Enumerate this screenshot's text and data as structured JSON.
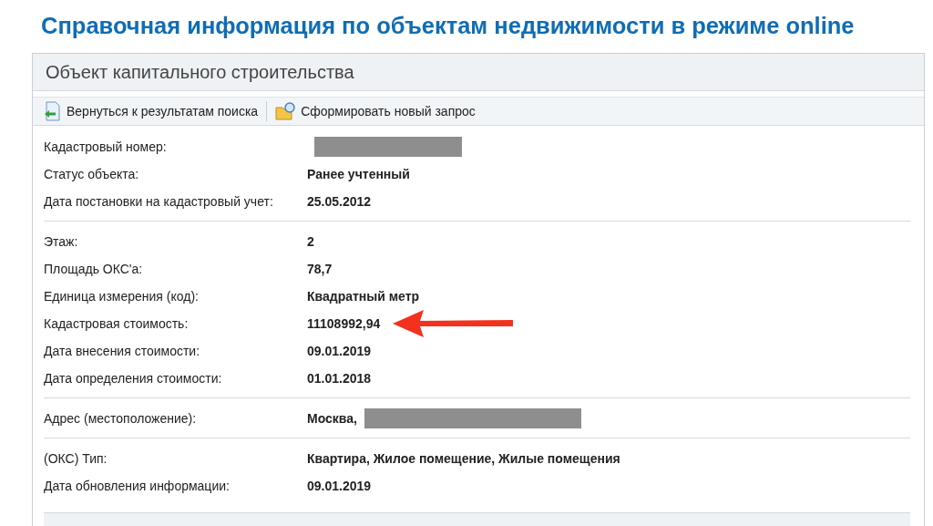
{
  "page_title": "Справочная информация по объектам недвижимости в режиме online",
  "panel": {
    "title": "Объект капитального строительства",
    "toolbar": [
      {
        "label": "Вернуться к результатам поиска",
        "kind": "back"
      },
      {
        "label": "Сформировать новый запрос",
        "kind": "query"
      }
    ],
    "groups": [
      [
        {
          "label": "Кадастровый номер:",
          "redacted": true
        },
        {
          "label": "Статус объекта:",
          "value": "Ранее учтенный"
        },
        {
          "label": "Дата постановки на кадастровый учет:",
          "value": "25.05.2012"
        }
      ],
      [
        {
          "label": "Этаж:",
          "value": "2"
        },
        {
          "label": "Площадь ОКС'а:",
          "value": "78,7"
        },
        {
          "label": "Единица измерения (код):",
          "value": "Квадратный метр"
        },
        {
          "label": "Кадастровая стоимость:",
          "value": "11108992,94",
          "annotated": true
        },
        {
          "label": "Дата внесения стоимости:",
          "value": "09.01.2019"
        },
        {
          "label": "Дата определения стоимости:",
          "value": "01.01.2018"
        }
      ],
      [
        {
          "label": "Адрес (местоположение):",
          "value": "Москва,",
          "redacted": true
        }
      ],
      [
        {
          "label": "(ОКС) Тип:",
          "value": "Квартира, Жилое помещение, Жилые помещения"
        },
        {
          "label": "Дата обновления информации:",
          "value": "09.01.2019"
        }
      ]
    ]
  }
}
